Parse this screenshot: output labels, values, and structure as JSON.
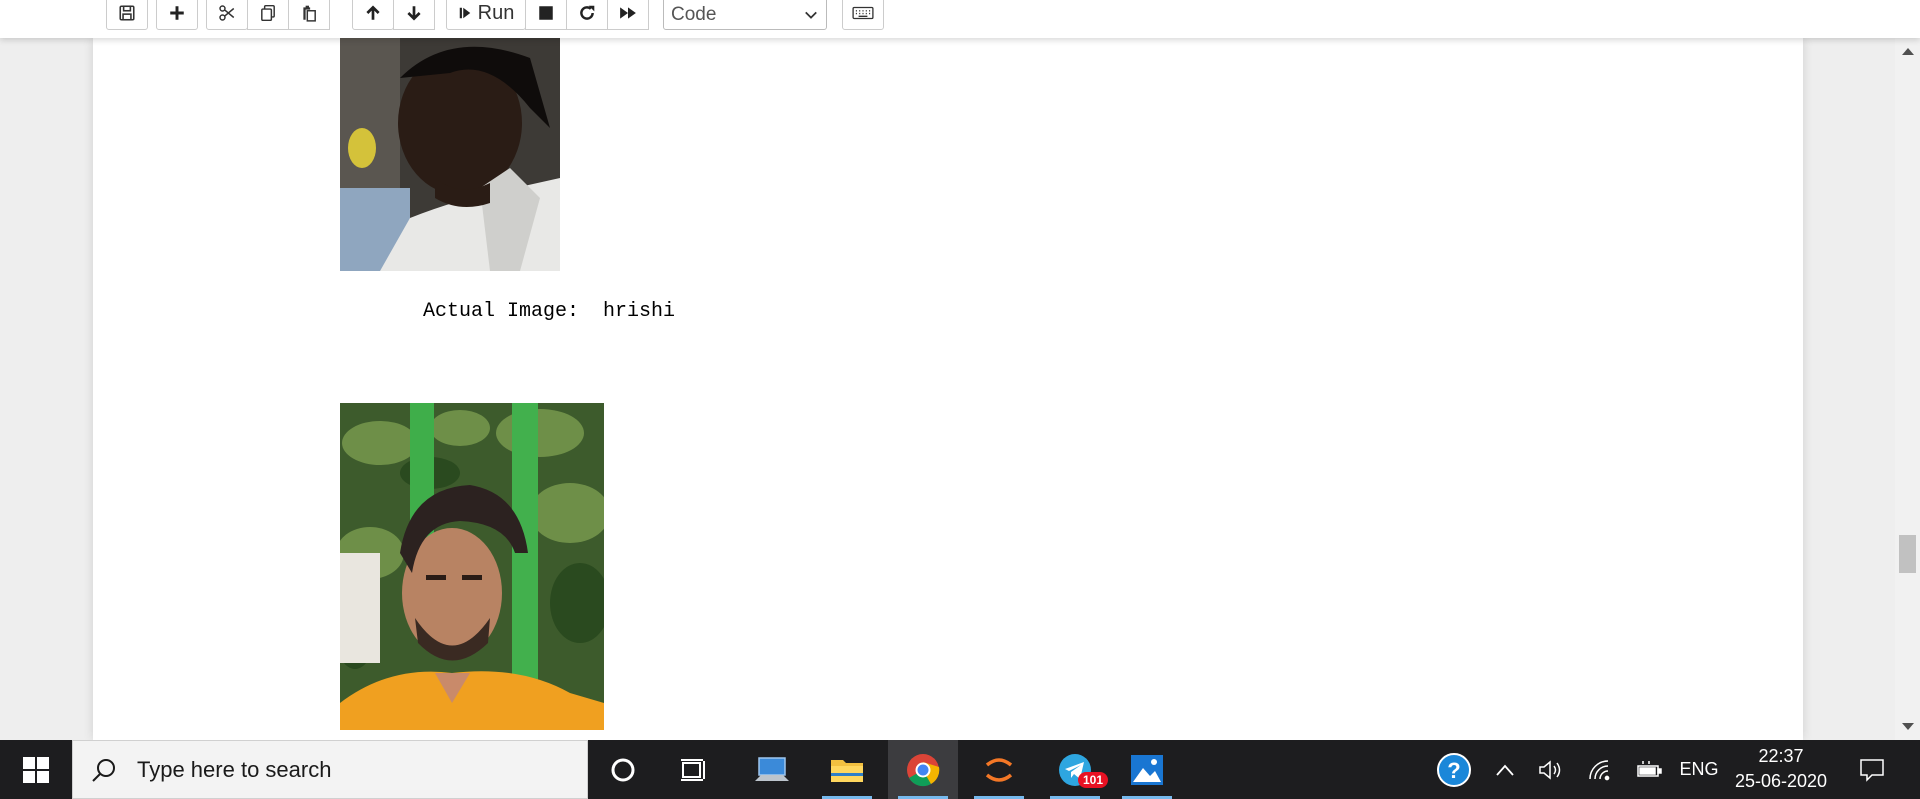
{
  "toolbar": {
    "run_label": "Run",
    "cell_type": "Code",
    "buttons": {
      "save": "save-icon",
      "insert": "plus-icon",
      "cut": "scissors-icon",
      "copy": "copy-icon",
      "paste": "paste-icon",
      "move_up": "arrow-up-icon",
      "move_down": "arrow-down-icon",
      "run": "step-forward-icon",
      "interrupt": "stop-icon",
      "restart": "restart-icon",
      "restart_run_all": "fast-forward-icon",
      "command_palette": "keyboard-icon"
    }
  },
  "notebook": {
    "output_text": "Actual Image:  hrishi"
  },
  "taskbar": {
    "search_placeholder": "Type here to search",
    "telegram_badge": "101",
    "language": "ENG",
    "time": "22:37",
    "date": "25-06-2020"
  },
  "colors": {
    "accent_underline": "#76b9ed",
    "taskbar_bg": "#1d1d1f",
    "badge": "#e81123"
  }
}
